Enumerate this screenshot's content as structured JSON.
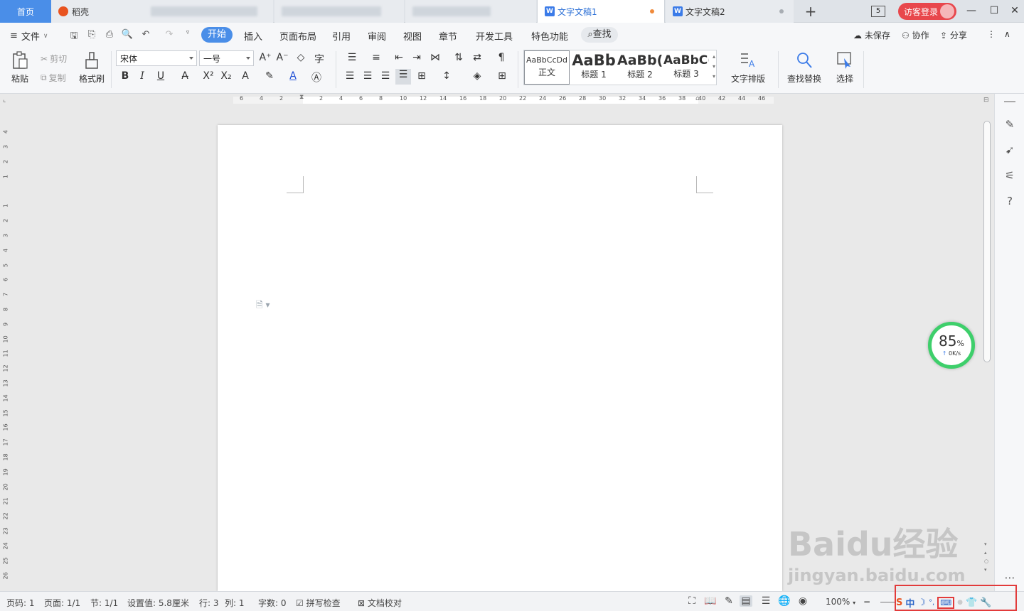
{
  "tabs": {
    "home": "首页",
    "daoke": "稻壳",
    "doc1": "文字文稿1",
    "doc2": "文字文稿2",
    "new": "+",
    "count": "5",
    "login": "访客登录"
  },
  "window": {
    "minimize": "—",
    "maximize": "☐",
    "close": "✕"
  },
  "menu": {
    "file": "文件",
    "start": "开始",
    "items": [
      "插入",
      "页面布局",
      "引用",
      "审阅",
      "视图",
      "章节",
      "开发工具",
      "特色功能"
    ],
    "find": "查找",
    "unsaved": "未保存",
    "collab": "协作",
    "share": "分享"
  },
  "ribbon": {
    "paste": "粘贴",
    "cut": "剪切",
    "copy": "复制",
    "format_painter": "格式刷",
    "font_name": "宋体",
    "font_size": "一号",
    "styles": [
      {
        "sample": "AaBbCcDd",
        "name": "正文"
      },
      {
        "sample": "AaBb",
        "name": "标题 1"
      },
      {
        "sample": "AaBb(",
        "name": "标题 2"
      },
      {
        "sample": "AaBbC(",
        "name": "标题 3"
      }
    ],
    "text_layout": "文字排版",
    "find_replace": "查找替换",
    "select": "选择"
  },
  "ruler": {
    "h_ticks": [
      "6",
      "4",
      "2",
      "2",
      "4",
      "6",
      "8",
      "10",
      "12",
      "14",
      "16",
      "18",
      "20",
      "22",
      "24",
      "26",
      "28",
      "30",
      "32",
      "34",
      "36",
      "38",
      "40",
      "42",
      "44",
      "46"
    ],
    "v_ticks": [
      "4",
      "3",
      "2",
      "1",
      "1",
      "2",
      "3",
      "4",
      "5",
      "6",
      "7",
      "8",
      "9",
      "10",
      "11",
      "12",
      "13",
      "14",
      "15",
      "16",
      "17",
      "18",
      "19",
      "20",
      "21",
      "22",
      "23",
      "24",
      "25",
      "26"
    ]
  },
  "progress": {
    "percent": "85",
    "unit": "%",
    "speed": "0K/s"
  },
  "status": {
    "page_num": "页码: 1",
    "pages": "页面: 1/1",
    "section": "节: 1/1",
    "setting": "设置值: 5.8厘米",
    "row": "行: 3",
    "col": "列: 1",
    "words": "字数: 0",
    "spell": "拼写检查",
    "proof": "文档校对",
    "zoom": "100%",
    "zoom_out": "−"
  },
  "ime": {
    "logo": "S",
    "lang": "中",
    "moon": "☽",
    "punct": "°,",
    "keyboard": "⌨",
    "shirt": "👕",
    "tool": "🔧"
  },
  "watermark": {
    "brand": "Baidu经验",
    "url": "jingyan.baidu.com"
  },
  "colors": {
    "accent": "#4a8ee8",
    "login": "#e8474c",
    "progress": "#3ecf6b",
    "highlight_box": "#e23b3b"
  }
}
